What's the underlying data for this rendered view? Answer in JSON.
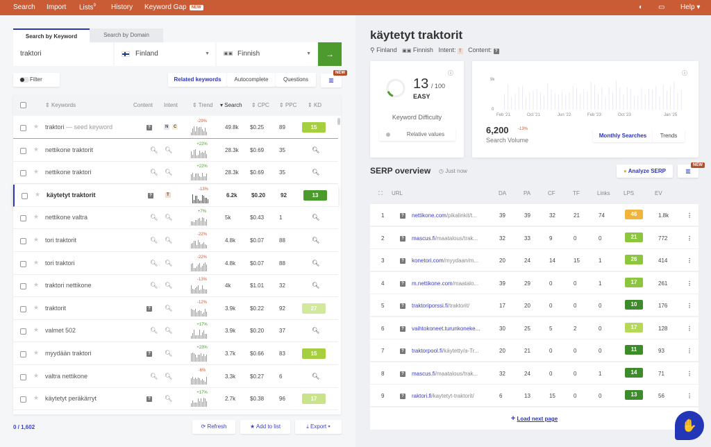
{
  "nav": {
    "items": [
      "Search",
      "Import",
      "Lists",
      "History",
      "Keyword Gap"
    ],
    "lists_count": "9",
    "new_badge": "NEW",
    "help": "Help"
  },
  "search": {
    "tabs": [
      "Search by Keyword",
      "Search by Domain"
    ],
    "keyword": "traktori",
    "country": "Finland",
    "language": "Finnish"
  },
  "filter": {
    "label": "Filter",
    "tabs": [
      "Related keywords",
      "Autocomplete",
      "Questions"
    ],
    "new_badge": "NEW"
  },
  "table": {
    "headers": [
      "Keywords",
      "Content",
      "Intent",
      "Trend",
      "Search",
      "CPC",
      "PPC",
      "KD"
    ],
    "rows": [
      {
        "kw": "traktori",
        "seed": "— seed keyword",
        "content": "?",
        "intent": [
          "N",
          "C"
        ],
        "trend": "-29%",
        "search": "49.8k",
        "cpc": "$0.25",
        "ppc": "89",
        "kd": "15",
        "kdc": "#a6cf3f"
      },
      {
        "kw": "nettikone traktorit",
        "content": "search",
        "intent": [
          "search"
        ],
        "trend": "+22%",
        "search": "28.3k",
        "cpc": "$0.69",
        "ppc": "35",
        "kd": ""
      },
      {
        "kw": "nettikone traktori",
        "content": "search",
        "intent": [
          "search"
        ],
        "trend": "+22%",
        "search": "28.3k",
        "cpc": "$0.69",
        "ppc": "35",
        "kd": ""
      },
      {
        "kw": "käytetyt traktorit",
        "content": "?",
        "intent": [
          "T"
        ],
        "trend": "-13%",
        "search": "6.2k",
        "cpc": "$0.20",
        "ppc": "92",
        "kd": "13",
        "kdc": "#4a9b2c",
        "active": true
      },
      {
        "kw": "nettikone valtra",
        "content": "search",
        "intent": [
          "search"
        ],
        "trend": "+7%",
        "search": "5k",
        "cpc": "$0.43",
        "ppc": "1",
        "kd": ""
      },
      {
        "kw": "tori traktorit",
        "content": "search",
        "intent": [
          "search"
        ],
        "trend": "-22%",
        "search": "4.8k",
        "cpc": "$0.07",
        "ppc": "88",
        "kd": ""
      },
      {
        "kw": "tori traktori",
        "content": "search",
        "intent": [
          "search"
        ],
        "trend": "-22%",
        "search": "4.8k",
        "cpc": "$0.07",
        "ppc": "88",
        "kd": ""
      },
      {
        "kw": "traktori nettikone",
        "content": "search",
        "intent": [
          "search"
        ],
        "trend": "-13%",
        "search": "4k",
        "cpc": "$1.01",
        "ppc": "32",
        "kd": ""
      },
      {
        "kw": "traktorit",
        "content": "?",
        "intent": [
          "search"
        ],
        "trend": "-12%",
        "search": "3.9k",
        "cpc": "$0.22",
        "ppc": "92",
        "kd": "27",
        "kdc": "#d2e89c"
      },
      {
        "kw": "valmet 502",
        "content": "search",
        "intent": [
          "search"
        ],
        "trend": "+17%",
        "search": "3.9k",
        "cpc": "$0.20",
        "ppc": "37",
        "kd": ""
      },
      {
        "kw": "myydään traktori",
        "content": "?",
        "intent": [
          "search"
        ],
        "trend": "+23%",
        "search": "3.7k",
        "cpc": "$0.66",
        "ppc": "83",
        "kd": "15",
        "kdc": "#a6cf3f"
      },
      {
        "kw": "valtra nettikone",
        "content": "search",
        "intent": [
          "search"
        ],
        "trend": "-6%",
        "search": "3.3k",
        "cpc": "$0.27",
        "ppc": "6",
        "kd": ""
      },
      {
        "kw": "käytetyt peräkärryt",
        "content": "?",
        "intent": [
          "search"
        ],
        "trend": "+17%",
        "search": "2.7k",
        "cpc": "$0.38",
        "ppc": "96",
        "kd": "17",
        "kdc": "#c8e38a"
      }
    ]
  },
  "footer": {
    "count": "0 / 1,602",
    "refresh": "Refresh",
    "add": "Add to list",
    "export": "Export"
  },
  "detail": {
    "title": "käytetyt traktorit",
    "country": "Finland",
    "language": "Finnish",
    "intent_label": "Intent:",
    "intent": "T",
    "content_label": "Content:",
    "content": "?",
    "kd": {
      "value": "13",
      "max": "/ 100",
      "level": "EASY",
      "label": "Keyword Difficulty",
      "relative": "Relative values",
      "percent": 13
    },
    "volume": {
      "value": "6,200",
      "change": "-13%",
      "label": "Search Volume",
      "y_ticks": [
        "9k",
        "0"
      ],
      "x_ticks": [
        "Feb '21",
        "Oct '21",
        "Jun '22",
        "Feb '23",
        "Oct '23",
        "Jan '25"
      ],
      "tabs": [
        "Monthly Searches",
        "Trends"
      ]
    }
  },
  "serp": {
    "title": "SERP overview",
    "time": "Just now",
    "analyze": "Analyze SERP",
    "new_badge": "NEW",
    "headers": [
      "URL",
      "DA",
      "PA",
      "CF",
      "TF",
      "Links",
      "LPS",
      "EV"
    ],
    "rows": [
      {
        "n": "1",
        "dom": "nettikone.com",
        "path": "/pikalinkit/t...",
        "da": "39",
        "pa": "39",
        "cf": "32",
        "tf": "21",
        "links": "74",
        "lps": "46",
        "c": "#f0b43c",
        "ev": "1.8k"
      },
      {
        "n": "2",
        "dom": "mascus.fi",
        "path": "/maatalous/trak...",
        "da": "32",
        "pa": "33",
        "cf": "9",
        "tf": "0",
        "links": "0",
        "lps": "21",
        "c": "#8cc63f",
        "ev": "772"
      },
      {
        "n": "3",
        "dom": "konetori.com",
        "path": "/myydaan/m...",
        "da": "20",
        "pa": "24",
        "cf": "14",
        "tf": "15",
        "links": "1",
        "lps": "26",
        "c": "#8cc63f",
        "ev": "414"
      },
      {
        "n": "4",
        "dom": "m.nettikone.com",
        "path": "/maatalo...",
        "da": "39",
        "pa": "29",
        "cf": "0",
        "tf": "0",
        "links": "1",
        "lps": "17",
        "c": "#8cc63f",
        "ev": "261"
      },
      {
        "n": "5",
        "dom": "traktoriporssi.fi",
        "path": "/traktorit/",
        "da": "17",
        "pa": "20",
        "cf": "0",
        "tf": "0",
        "links": "0",
        "lps": "10",
        "c": "#3d8b2a",
        "ev": "176"
      },
      {
        "n": "6",
        "dom": "vaihtokoneet.turunkoneke...",
        "path": "",
        "da": "30",
        "pa": "25",
        "cf": "5",
        "tf": "2",
        "links": "0",
        "lps": "17",
        "c": "#b5d957",
        "ev": "128"
      },
      {
        "n": "7",
        "dom": "traktorpool.fi",
        "path": "/käytetty/a-Tr...",
        "da": "20",
        "pa": "21",
        "cf": "0",
        "tf": "0",
        "links": "0",
        "lps": "11",
        "c": "#3d8b2a",
        "ev": "93"
      },
      {
        "n": "8",
        "dom": "mascus.fi",
        "path": "/maatalous/trak...",
        "da": "32",
        "pa": "24",
        "cf": "0",
        "tf": "0",
        "links": "1",
        "lps": "14",
        "c": "#3d8b2a",
        "ev": "71"
      },
      {
        "n": "9",
        "dom": "raktori.fi",
        "path": "/kaytetyt-traktorit/",
        "da": "6",
        "pa": "13",
        "cf": "15",
        "tf": "0",
        "links": "0",
        "lps": "13",
        "c": "#3d8b2a",
        "ev": "56"
      }
    ],
    "load_more": "Load next page"
  }
}
